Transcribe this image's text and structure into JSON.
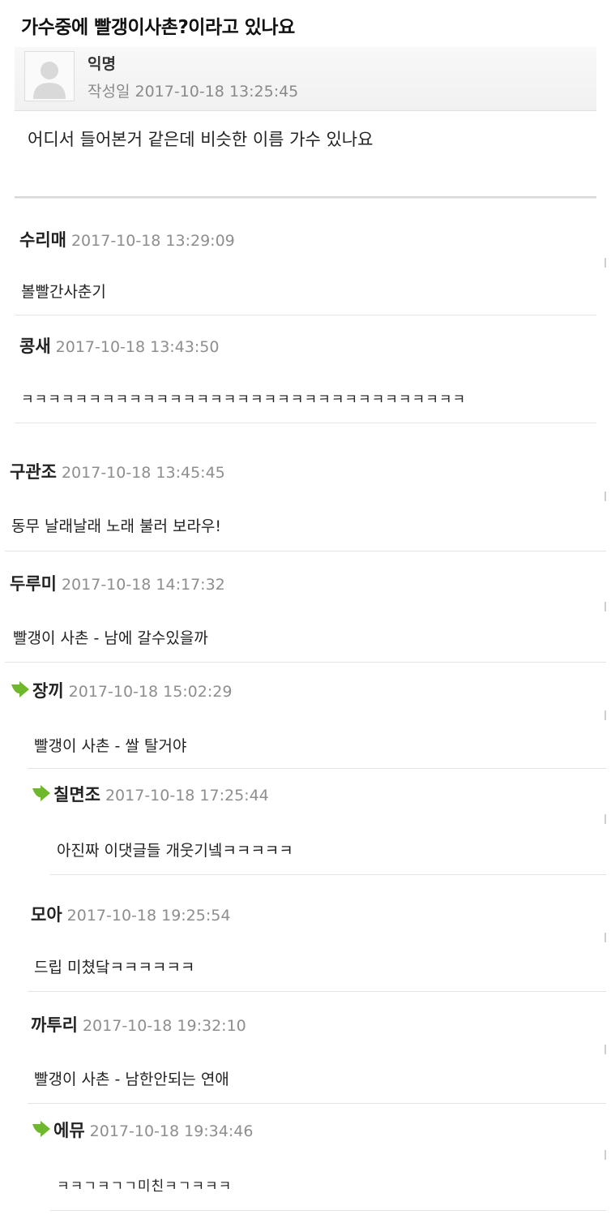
{
  "post": {
    "title": "가수중에 빨갱이사촌?이라고 있나요",
    "author": "익명",
    "date": "작성일 2017-10-18 13:25:45",
    "body": "어디서 들어본거 같은데 비슷한 이름 가수 있나요"
  },
  "comments": [
    {
      "nick": "수리매",
      "date": "2017-10-18 13:29:09",
      "text": "볼빨간사춘기"
    },
    {
      "nick": "콩새",
      "date": "2017-10-18 13:43:50",
      "text": "ㅋㅋㅋㅋㅋㅋㅋㅋㅋㅋㅋㅋㅋㅋㅋㅋㅋㅋㅋㅋㅋㅋㅋㅋㅋㅋㅋㅋㅋㅋㅋㅋㅋ"
    },
    {
      "nick": "구관조",
      "date": "2017-10-18 13:45:45",
      "text": "동무 날래날래 노래 불러 보라우!"
    },
    {
      "nick": "두루미",
      "date": "2017-10-18 14:17:32",
      "text": "빨갱이 사촌 - 남에 갈수있을까"
    },
    {
      "nick": "장끼",
      "date": "2017-10-18 15:02:29",
      "text": "빨갱이 사촌 - 쌀 탈거야"
    },
    {
      "nick": "칠면조",
      "date": "2017-10-18 17:25:44",
      "text": "아진짜 이댓글들 개웃기넼ㅋㅋㅋㅋㅋ"
    },
    {
      "nick": "모아",
      "date": "2017-10-18 19:25:54",
      "text": "드립 미쳤닼ㅋㅋㅋㅋㅋㅋ"
    },
    {
      "nick": "까투리",
      "date": "2017-10-18 19:32:10",
      "text": "빨갱이 사촌 - 남한안되는 연애"
    },
    {
      "nick": "에뮤",
      "date": "2017-10-18 19:34:46",
      "text": "ㅋㅋㄱㅋㄱㄱ미친ㅋㄱㅋㅋㅋ"
    }
  ],
  "colors": {
    "reply_arrow": "#6fb82e",
    "date_gray": "#8e8e8e"
  },
  "icons": [
    "avatar-placeholder-icon",
    "reply-arrow-icon"
  ]
}
